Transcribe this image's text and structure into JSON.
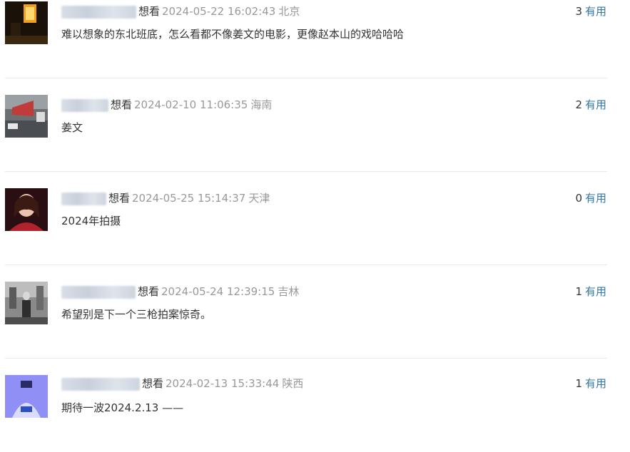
{
  "vote_label": "有用",
  "comments": [
    {
      "rating": "想看",
      "time": "2024-05-22 16:02:43",
      "location": "北京",
      "votes": "3",
      "content": "难以想象的东北班底，怎么看都不像姜文的电影，更像赵本山的戏哈哈哈",
      "avatar_icon": "neon-window-avatar-icon"
    },
    {
      "rating": "想看",
      "time": "2024-02-10 11:06:35",
      "location": "海南",
      "votes": "2",
      "content": "姜文",
      "avatar_icon": "street-scene-avatar-icon"
    },
    {
      "rating": "想看",
      "time": "2024-05-25 15:14:37",
      "location": "天津",
      "votes": "0",
      "content": "2024年拍摄",
      "avatar_icon": "portrait-avatar-icon"
    },
    {
      "rating": "想看",
      "time": "2024-05-24 12:39:15",
      "location": "吉林",
      "votes": "1",
      "content": "希望别是下一个三枪拍案惊奇。",
      "avatar_icon": "bw-photo-avatar-icon"
    },
    {
      "rating": "想看",
      "time": "2024-02-13 15:33:44",
      "location": "陕西",
      "votes": "1",
      "content": "期待一波2024.2.13 ——",
      "avatar_icon": "blue-figure-avatar-icon"
    }
  ]
}
